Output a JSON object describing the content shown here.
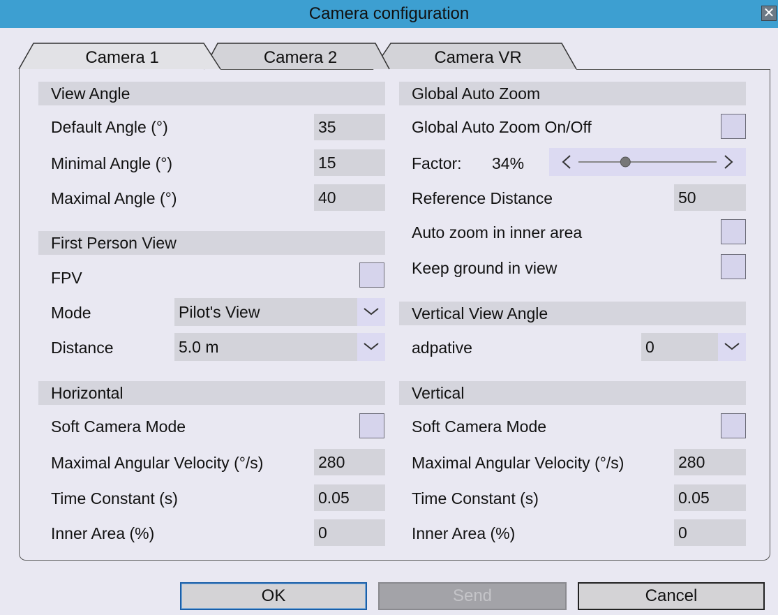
{
  "window": {
    "title": "Camera configuration",
    "close_glyph": "✕"
  },
  "tabs": [
    {
      "label": "Camera 1",
      "active": true
    },
    {
      "label": "Camera 2",
      "active": false
    },
    {
      "label": "Camera VR",
      "active": false
    }
  ],
  "view_angle": {
    "title": "View Angle",
    "default_label": "Default Angle (°)",
    "default_value": "35",
    "min_label": "Minimal Angle (°)",
    "min_value": "15",
    "max_label": "Maximal Angle (°)",
    "max_value": "40"
  },
  "fpv": {
    "title": "First Person View",
    "fpv_label": "FPV",
    "fpv_checked": false,
    "mode_label": "Mode",
    "mode_value": "Pilot's View",
    "distance_label": "Distance",
    "distance_value": "5.0 m"
  },
  "horizontal": {
    "title": "Horizontal",
    "soft_label": "Soft Camera Mode",
    "soft_checked": false,
    "velocity_label": "Maximal Angular Velocity (°/s)",
    "velocity_value": "280",
    "time_label": "Time Constant (s)",
    "time_value": "0.05",
    "inner_label": "Inner Area (%)",
    "inner_value": "0"
  },
  "auto_zoom": {
    "title": "Global Auto Zoom",
    "onoff_label": "Global Auto Zoom On/Off",
    "onoff_checked": false,
    "factor_label": "Factor:",
    "factor_value": "34%",
    "factor_fraction": 0.34,
    "ref_label": "Reference Distance",
    "ref_value": "50",
    "inner_label": "Auto zoom in inner area",
    "inner_checked": false,
    "ground_label": "Keep ground in view",
    "ground_checked": false
  },
  "vertical_view_angle": {
    "title": "Vertical View Angle",
    "mode_label": "adpative",
    "mode_value": "0"
  },
  "vertical": {
    "title": "Vertical",
    "soft_label": "Soft Camera Mode",
    "soft_checked": false,
    "velocity_label": "Maximal Angular Velocity (°/s)",
    "velocity_value": "280",
    "time_label": "Time Constant (s)",
    "time_value": "0.05",
    "inner_label": "Inner Area (%)",
    "inner_value": "0"
  },
  "buttons": {
    "ok": "OK",
    "send": "Send",
    "cancel": "Cancel"
  },
  "colors": {
    "titlebar": "#3d9fd1",
    "background": "#e9e8f2",
    "field": "#d3d3da",
    "checkbox": "#d6d4ec"
  }
}
